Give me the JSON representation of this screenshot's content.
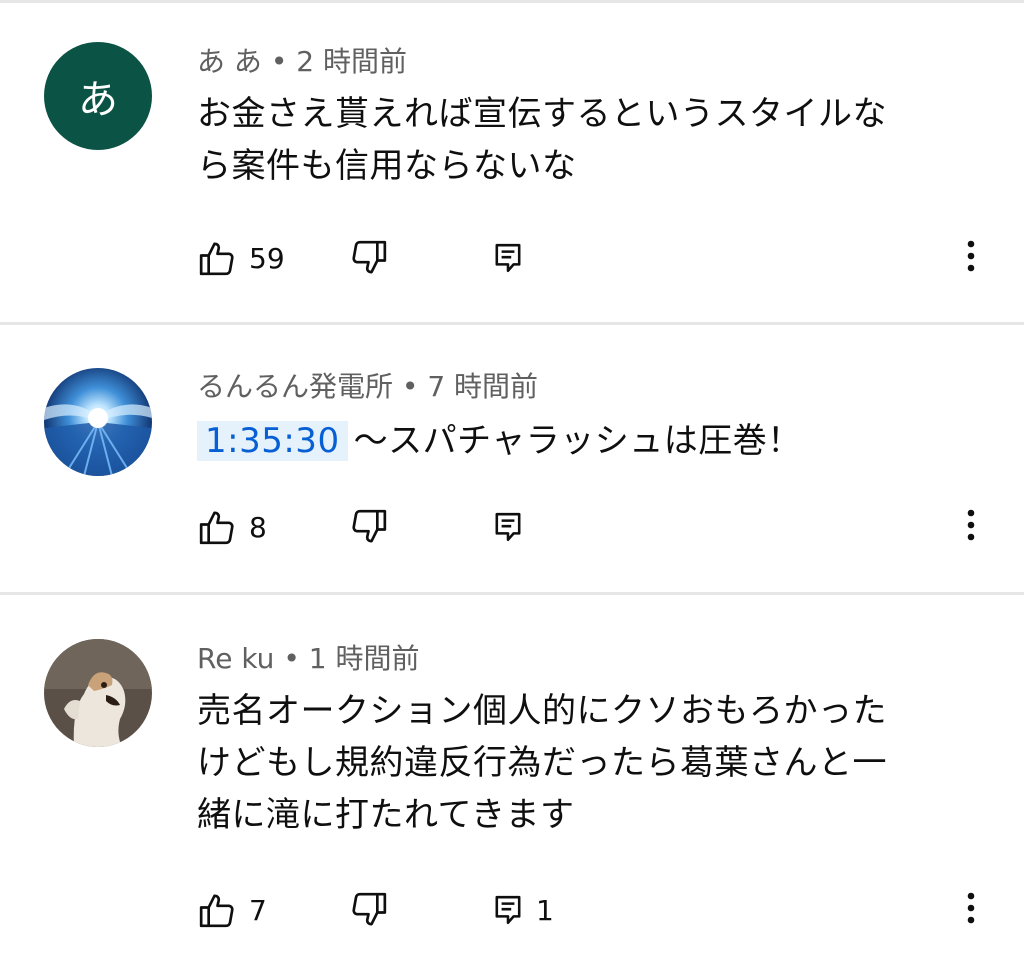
{
  "comments": [
    {
      "avatar_letter": "あ",
      "avatar_color": "#0b5345",
      "author": "あ あ",
      "time": "2 時間前",
      "timestamp": "",
      "text_lines": [
        "お金さえ貰えれば宣伝するというスタイルな",
        "ら案件も信用ならないな"
      ],
      "likes": "59",
      "replies": ""
    },
    {
      "avatar_letter": "",
      "avatar_color": "",
      "author": "るんるん発電所",
      "time": "7 時間前",
      "timestamp": "1:35:30",
      "text_lines": [
        "～スパチャラッシュは圧巻！"
      ],
      "likes": "8",
      "replies": ""
    },
    {
      "avatar_letter": "",
      "avatar_color": "",
      "author": "Re ku",
      "time": "1 時間前",
      "timestamp": "",
      "text_lines": [
        "売名オークション個人的にクソおもろかった",
        "けどもし規約違反行為だったら葛葉さんと一",
        "緒に滝に打たれてきます"
      ],
      "likes": "7",
      "replies": "1"
    }
  ],
  "separator": "•",
  "icons": {
    "like": "thumb-up-icon",
    "dislike": "thumb-down-icon",
    "reply": "comment-icon",
    "more": "more-vert-icon"
  }
}
